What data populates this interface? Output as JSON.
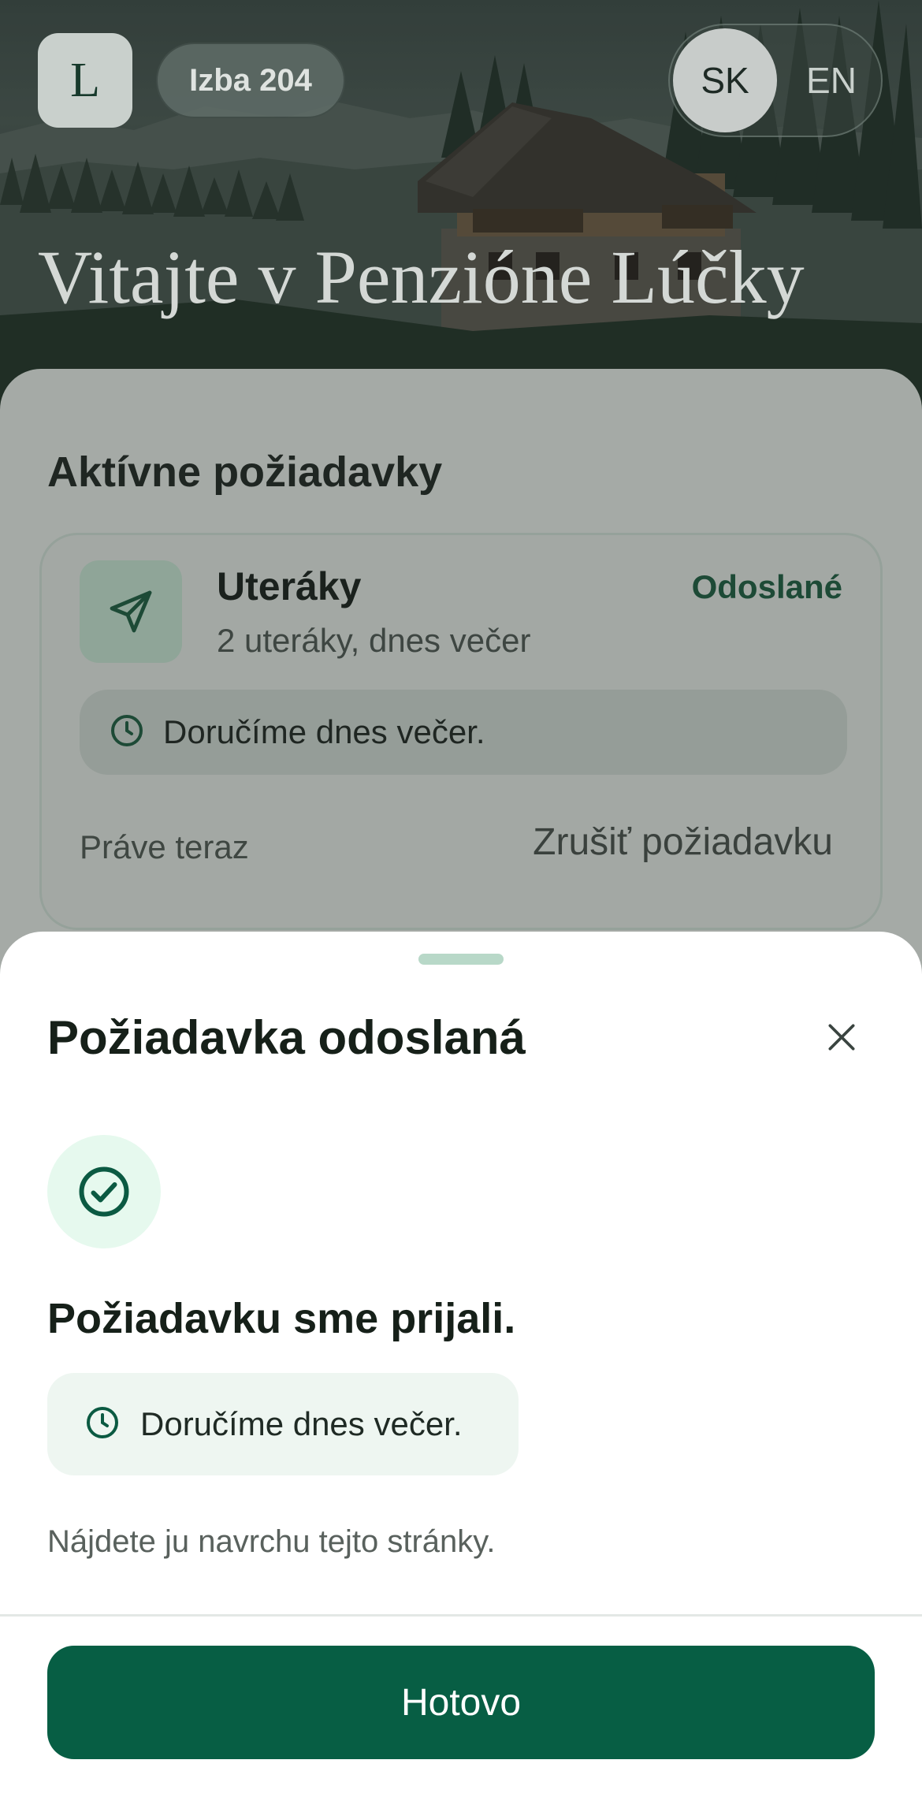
{
  "header": {
    "logo_letter": "L",
    "room_label": "Izba 204",
    "languages": [
      "SK",
      "EN"
    ],
    "active_language": "SK",
    "title": "Vitajte v Penzióne Lúčky"
  },
  "active_requests": {
    "section_title": "Aktívne požiadavky",
    "items": [
      {
        "icon": "send-icon",
        "title": "Uteráky",
        "status": "Odoslané",
        "detail": "2 uteráky, dnes večer",
        "eta_icon": "clock-icon",
        "eta": "Doručíme dnes večer.",
        "time": "Práve teraz",
        "cancel_label": "Zrušiť požiadavku"
      }
    ]
  },
  "sheet": {
    "title": "Požiadavka odoslaná",
    "close_icon": "close-icon",
    "success_icon": "check-circle-icon",
    "confirmation": "Požiadavku sme prijali.",
    "eta_icon": "clock-icon",
    "eta": "Doručíme dnes večer.",
    "hint": "Nájdete ju navrchu tejto stránky.",
    "done_label": "Hotovo"
  },
  "colors": {
    "primary": "#075e44",
    "success_bg": "#e6f9ee",
    "chip_bg": "#eef6f1",
    "grabber": "#b8d8c8"
  }
}
